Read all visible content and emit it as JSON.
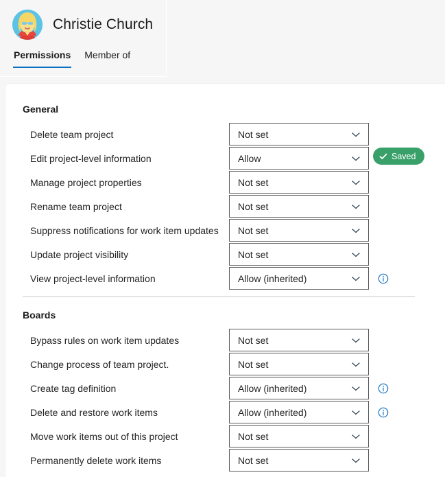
{
  "header": {
    "person_name": "Christie Church",
    "avatar_alt": "user-avatar",
    "tabs": [
      {
        "label": "Permissions",
        "active": true
      },
      {
        "label": "Member of",
        "active": false
      }
    ]
  },
  "status_badge": {
    "label": "Saved",
    "icon": "check-icon",
    "color": "#3aa06a",
    "text_color": "#ffffff"
  },
  "colors": {
    "accent": "#0c70c0",
    "info_icon": "#0a6cc1",
    "page_background": "#f6f6f6",
    "card_background": "#ffffff",
    "label_text": "#242424",
    "dropdown_border": "#595959",
    "divider": "#c8c8c8"
  },
  "sections": [
    {
      "title": "General",
      "rows": [
        {
          "label": "Delete team project",
          "value": "Not set",
          "info": false
        },
        {
          "label": "Edit project-level information",
          "value": "Allow",
          "info": false
        },
        {
          "label": "Manage project properties",
          "value": "Not set",
          "info": false
        },
        {
          "label": "Rename team project",
          "value": "Not set",
          "info": false
        },
        {
          "label": "Suppress notifications for work item updates",
          "value": "Not set",
          "info": false
        },
        {
          "label": "Update project visibility",
          "value": "Not set",
          "info": false
        },
        {
          "label": "View project-level information",
          "value": "Allow (inherited)",
          "info": true
        }
      ]
    },
    {
      "title": "Boards",
      "rows": [
        {
          "label": "Bypass rules on work item updates",
          "value": "Not set",
          "info": false
        },
        {
          "label": "Change process of team project.",
          "value": "Not set",
          "info": false
        },
        {
          "label": "Create tag definition",
          "value": "Allow (inherited)",
          "info": true
        },
        {
          "label": "Delete and restore work items",
          "value": "Allow (inherited)",
          "info": true
        },
        {
          "label": "Move work items out of this project",
          "value": "Not set",
          "info": false
        },
        {
          "label": "Permanently delete work items",
          "value": "Not set",
          "info": false
        }
      ]
    }
  ]
}
